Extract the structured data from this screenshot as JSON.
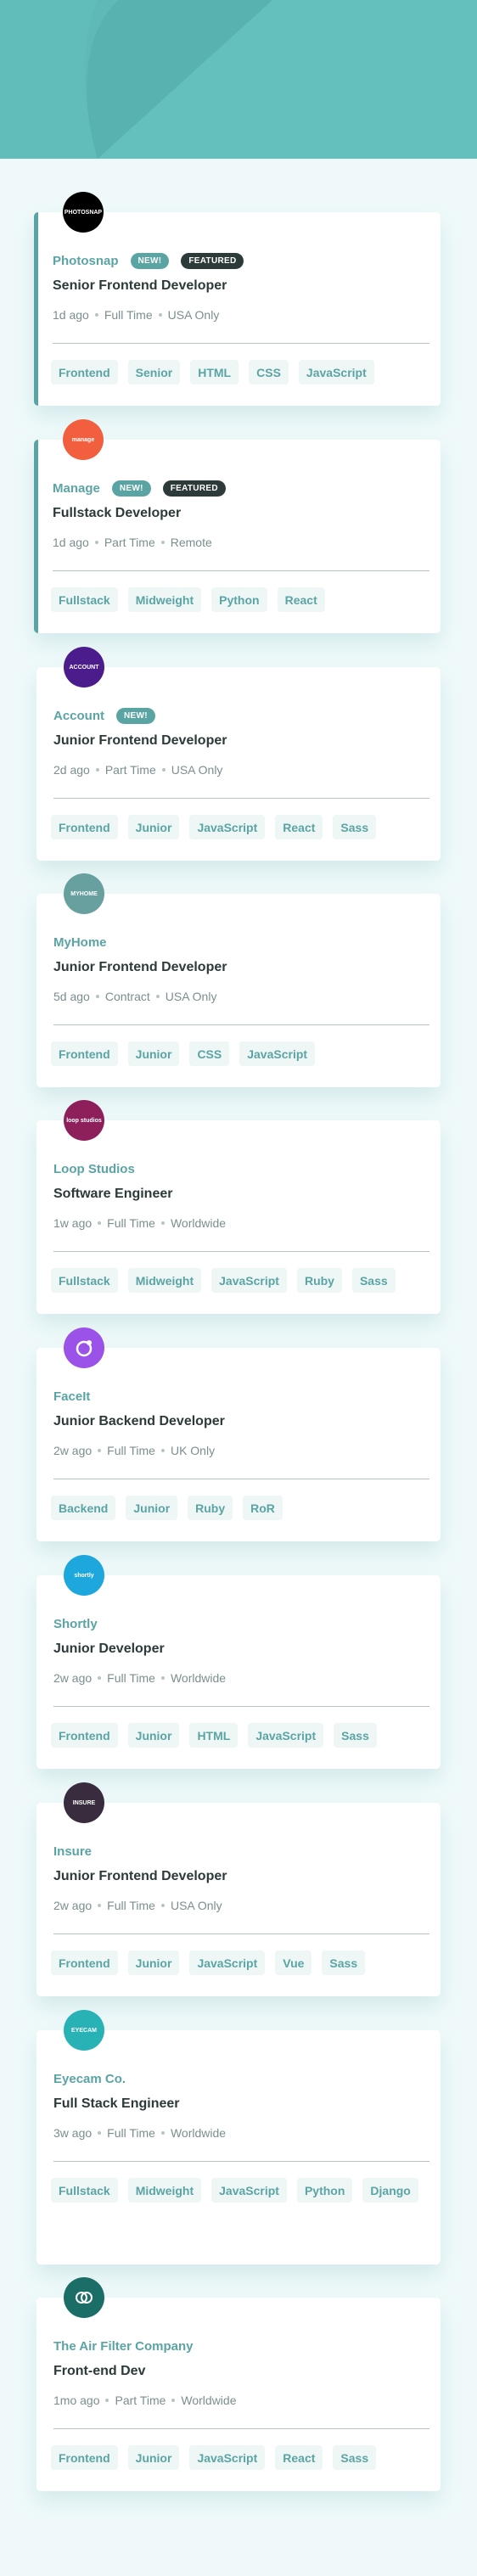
{
  "colors": {
    "primary": "#5ba4a4",
    "header": "#5fbab5",
    "background": "#eff9fa",
    "dark": "#2c3a3a",
    "tag_bg": "#eef6f6"
  },
  "jobs": [
    {
      "company": "Photosnap",
      "logo_text": "PHOTOSNAP",
      "logo_color": "#000000",
      "new": "NEW!",
      "featured": "FEATURED",
      "position": "Senior Frontend Developer",
      "posted": "1d ago",
      "contract": "Full Time",
      "location": "USA Only",
      "tags": [
        "Frontend",
        "Senior",
        "HTML",
        "CSS",
        "JavaScript"
      ]
    },
    {
      "company": "Manage",
      "logo_text": "manage",
      "logo_color": "#f15f3e",
      "new": "NEW!",
      "featured": "FEATURED",
      "position": "Fullstack Developer",
      "posted": "1d ago",
      "contract": "Part Time",
      "location": "Remote",
      "tags": [
        "Fullstack",
        "Midweight",
        "Python",
        "React"
      ]
    },
    {
      "company": "Account",
      "logo_text": "ACCOUNT",
      "logo_color": "#4b1c8c",
      "new": "NEW!",
      "featured": "",
      "position": "Junior Frontend Developer",
      "posted": "2d ago",
      "contract": "Part Time",
      "location": "USA Only",
      "tags": [
        "Frontend",
        "Junior",
        "JavaScript",
        "React",
        "Sass"
      ]
    },
    {
      "company": "MyHome",
      "logo_text": "MYHOME",
      "logo_color": "#68a09f",
      "new": "",
      "featured": "",
      "position": "Junior Frontend Developer",
      "posted": "5d ago",
      "contract": "Contract",
      "location": "USA Only",
      "tags": [
        "Frontend",
        "Junior",
        "CSS",
        "JavaScript"
      ]
    },
    {
      "company": "Loop Studios",
      "logo_text": "loop studios",
      "logo_color": "#8d1f5b",
      "new": "",
      "featured": "",
      "position": "Software Engineer",
      "posted": "1w ago",
      "contract": "Full Time",
      "location": "Worldwide",
      "tags": [
        "Fullstack",
        "Midweight",
        "JavaScript",
        "Ruby",
        "Sass"
      ]
    },
    {
      "company": "FaceIt",
      "logo_text": "",
      "logo_color": "#9b52e8",
      "new": "",
      "featured": "",
      "position": "Junior Backend Developer",
      "posted": "2w ago",
      "contract": "Full Time",
      "location": "UK Only",
      "tags": [
        "Backend",
        "Junior",
        "Ruby",
        "RoR"
      ]
    },
    {
      "company": "Shortly",
      "logo_text": "shortly",
      "logo_color": "#1da7dc",
      "new": "",
      "featured": "",
      "position": "Junior Developer",
      "posted": "2w ago",
      "contract": "Full Time",
      "location": "Worldwide",
      "tags": [
        "Frontend",
        "Junior",
        "HTML",
        "JavaScript",
        "Sass"
      ]
    },
    {
      "company": "Insure",
      "logo_text": "INSURE",
      "logo_color": "#3a2c3f",
      "new": "",
      "featured": "",
      "position": "Junior Frontend Developer",
      "posted": "2w ago",
      "contract": "Full Time",
      "location": "USA Only",
      "tags": [
        "Frontend",
        "Junior",
        "JavaScript",
        "Vue",
        "Sass"
      ]
    },
    {
      "company": "Eyecam Co.",
      "logo_text": "EYECAM",
      "logo_color": "#28b2b6",
      "new": "",
      "featured": "",
      "position": "Full Stack Engineer",
      "posted": "3w ago",
      "contract": "Full Time",
      "location": "Worldwide",
      "tags": [
        "Fullstack",
        "Midweight",
        "JavaScript",
        "Python",
        "Django"
      ]
    },
    {
      "company": "The Air Filter Company",
      "logo_text": "",
      "logo_color": "#1b6e67",
      "new": "",
      "featured": "",
      "position": "Front-end Dev",
      "posted": "1mo ago",
      "contract": "Part Time",
      "location": "Worldwide",
      "tags": [
        "Frontend",
        "Junior",
        "JavaScript",
        "React",
        "Sass"
      ]
    }
  ]
}
